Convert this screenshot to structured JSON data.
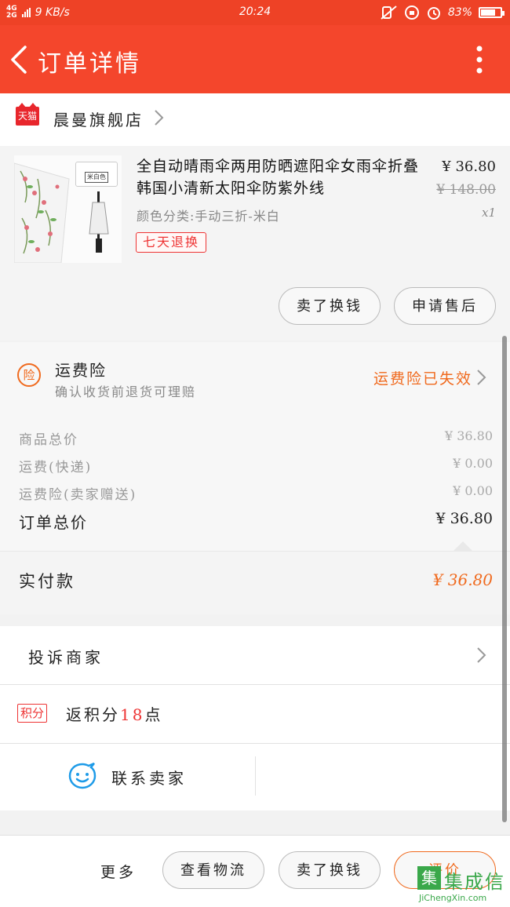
{
  "status_bar": {
    "network": [
      "4G",
      "2G"
    ],
    "speed": "9 KB/s",
    "time": "20:24",
    "battery": "83%",
    "battery_level": 0.83
  },
  "header": {
    "title": "订单详情"
  },
  "shop": {
    "badge": "天猫",
    "name": "晨曼旗舰店"
  },
  "product": {
    "name": "全自动晴雨伞两用防晒遮阳伞女雨伞折叠韩国小清新太阳伞防紫外线",
    "spec": "颜色分类:手动三折-米白",
    "image_label": "米白色",
    "tag": "七天退换",
    "price": "¥ 36.80",
    "original_price": "¥ 148.00",
    "quantity": "x1",
    "buttons": {
      "refund": "卖了换钱",
      "aftersale": "申请售后"
    }
  },
  "insurance": {
    "icon": "险",
    "title": "运费险",
    "subtitle": "确认收货前退货可理赔",
    "status": "运费险已失效"
  },
  "costs": {
    "rows": [
      {
        "label": "商品总价",
        "value": "¥ 36.80"
      },
      {
        "label": "运费(快递)",
        "value": "¥ 0.00"
      },
      {
        "label": "运费险(卖家赠送)",
        "value": "¥ 0.00"
      }
    ],
    "total_label": "订单总价",
    "total_value": "¥ 36.80"
  },
  "paid": {
    "label": "实付款",
    "value": "¥ 36.80"
  },
  "complain": {
    "label": "投诉商家"
  },
  "points": {
    "badge": "积分",
    "prefix": "返积分",
    "count": "18",
    "suffix": "点"
  },
  "contact": {
    "label": "联系卖家"
  },
  "bottom_bar": {
    "more": "更多",
    "logistics": "查看物流",
    "refund": "卖了换钱",
    "rate": "评价"
  },
  "watermark": {
    "cn": "集成信",
    "en": "JiChengXin.com"
  },
  "colors": {
    "header": "#f4462c",
    "accent": "#f06a1e",
    "red": "#e33333"
  }
}
